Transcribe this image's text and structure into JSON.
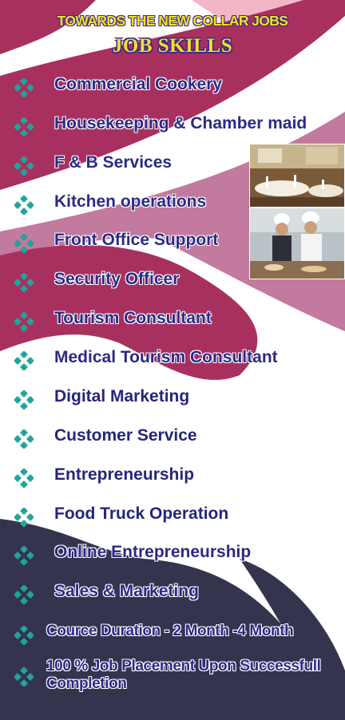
{
  "header": {
    "tagline": "TOWARDS THE NEW COLLAR JOBS",
    "headline": "JOB SKILLS"
  },
  "skills": [
    "Commercial Cookery",
    "Housekeeping & Chamber maid",
    "F & B Services",
    "Kitchen operations",
    "Front Office Support",
    "Security Officer",
    "Tourism Consultant",
    "Medical Tourism Consultant",
    "Digital Marketing",
    "Customer Service",
    "Entrepreneurship",
    "Food Truck Operation",
    "Online Entrepreneurship",
    "Sales & Marketing"
  ],
  "footer_items": [
    "Cource Duration - 2 Month -4 Month",
    "100 % Job Placement Upon Successfull Completion"
  ],
  "photos": [
    "restaurant-dining-photo",
    "chefs-kitchen-photo"
  ],
  "colors": {
    "magenta": "#a8305f",
    "pink": "#c27a9e",
    "light_pink": "#f2b6c6",
    "navy": "#35344f",
    "text_blue": "#27257a",
    "bullet_teal": "#1fa59b",
    "title_yellow": "#f3e021"
  }
}
